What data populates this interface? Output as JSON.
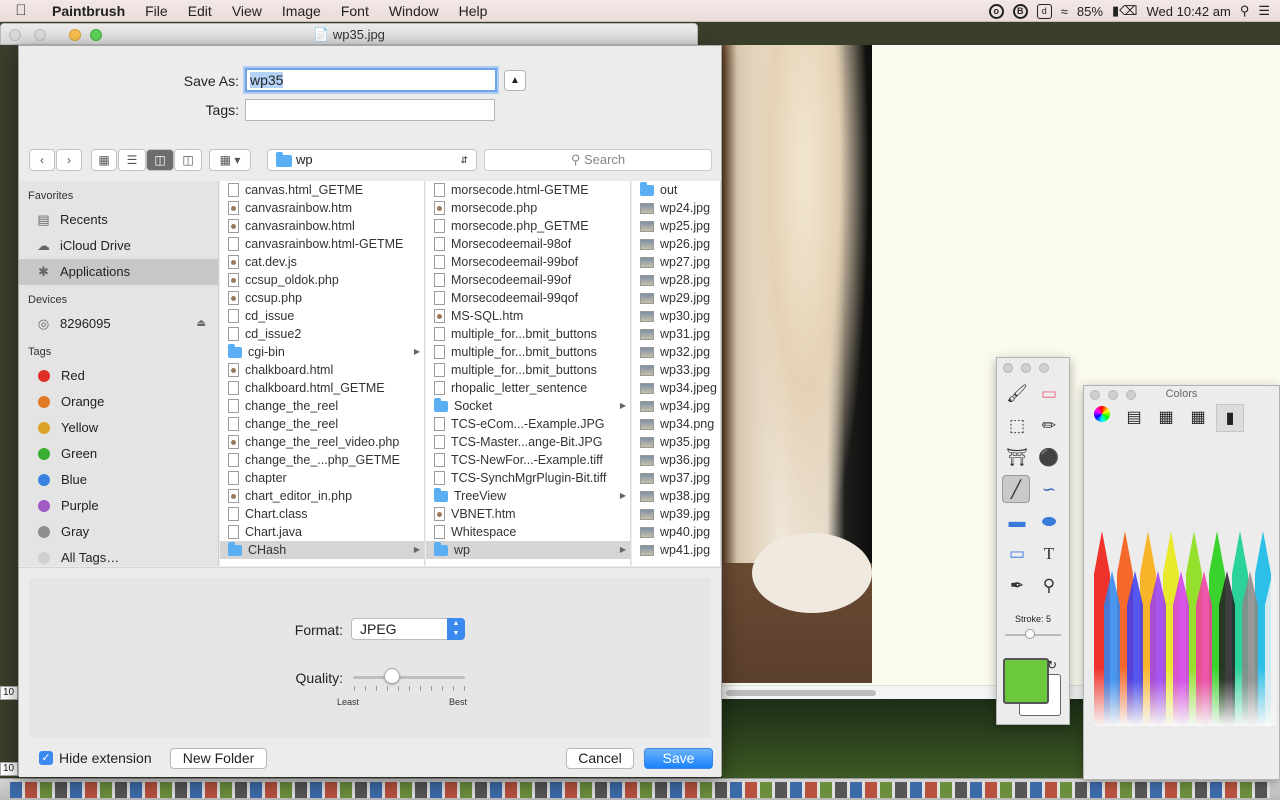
{
  "menubar": {
    "app": "Paintbrush",
    "items": [
      "File",
      "Edit",
      "View",
      "Image",
      "Font",
      "Window",
      "Help"
    ],
    "battery": "85%",
    "clock": "Wed 10:42 am"
  },
  "background_window": {
    "title": "wp35.jpg"
  },
  "save_sheet": {
    "save_as_label": "Save As:",
    "save_as_value": "wp35",
    "tags_label": "Tags:",
    "tags_value": "",
    "path": "wp",
    "search_placeholder": "Search",
    "sidebar": {
      "favorites_header": "Favorites",
      "favorites": [
        {
          "label": "Recents",
          "icon": "recents-icon"
        },
        {
          "label": "iCloud Drive",
          "icon": "cloud-icon"
        },
        {
          "label": "Applications",
          "icon": "applications-icon",
          "selected": true
        }
      ],
      "devices_header": "Devices",
      "devices": [
        {
          "label": "8296095",
          "icon": "disk-icon"
        }
      ],
      "tags_header": "Tags",
      "tags": [
        {
          "label": "Red",
          "color": "#e0302a"
        },
        {
          "label": "Orange",
          "color": "#e07a25"
        },
        {
          "label": "Yellow",
          "color": "#dca52a"
        },
        {
          "label": "Green",
          "color": "#3aae33"
        },
        {
          "label": "Blue",
          "color": "#3a82e0"
        },
        {
          "label": "Purple",
          "color": "#a05ac3"
        },
        {
          "label": "Gray",
          "color": "#8d8d8d"
        },
        {
          "label": "All Tags…",
          "color": "#d0d0d0"
        }
      ]
    },
    "columns": [
      {
        "items": [
          {
            "name": "canvas.html_GETME",
            "type": "doc"
          },
          {
            "name": "canvasrainbow.htm",
            "type": "html"
          },
          {
            "name": "canvasrainbow.html",
            "type": "html"
          },
          {
            "name": "canvasrainbow.html-GETME",
            "type": "doc"
          },
          {
            "name": "cat.dev.js",
            "type": "php"
          },
          {
            "name": "ccsup_oldok.php",
            "type": "php"
          },
          {
            "name": "ccsup.php",
            "type": "php"
          },
          {
            "name": "cd_issue",
            "type": "doc"
          },
          {
            "name": "cd_issue2",
            "type": "doc"
          },
          {
            "name": "cgi-bin",
            "type": "folder",
            "arrow": true
          },
          {
            "name": "chalkboard.html",
            "type": "html"
          },
          {
            "name": "chalkboard.html_GETME",
            "type": "doc"
          },
          {
            "name": "change_the_reel",
            "type": "doc"
          },
          {
            "name": "change_the_reel",
            "type": "doc"
          },
          {
            "name": "change_the_reel_video.php",
            "type": "php"
          },
          {
            "name": "change_the_...php_GETME",
            "type": "doc"
          },
          {
            "name": "chapter",
            "type": "doc"
          },
          {
            "name": "chart_editor_in.php",
            "type": "php"
          },
          {
            "name": "Chart.class",
            "type": "doc"
          },
          {
            "name": "Chart.java",
            "type": "doc"
          },
          {
            "name": "CHash",
            "type": "folder",
            "arrow": true,
            "selected": true
          }
        ]
      },
      {
        "items": [
          {
            "name": "morsecode.html-GETME",
            "type": "doc"
          },
          {
            "name": "morsecode.php",
            "type": "php"
          },
          {
            "name": "morsecode.php_GETME",
            "type": "doc"
          },
          {
            "name": "Morsecodeemail-98of",
            "type": "doc"
          },
          {
            "name": "Morsecodeemail-99bof",
            "type": "doc"
          },
          {
            "name": "Morsecodeemail-99of",
            "type": "doc"
          },
          {
            "name": "Morsecodeemail-99qof",
            "type": "doc"
          },
          {
            "name": "MS-SQL.htm",
            "type": "html"
          },
          {
            "name": "multiple_for...bmit_buttons",
            "type": "doc"
          },
          {
            "name": "multiple_for...bmit_buttons",
            "type": "doc"
          },
          {
            "name": "multiple_for...bmit_buttons",
            "type": "doc"
          },
          {
            "name": "rhopalic_letter_sentence",
            "type": "doc"
          },
          {
            "name": "Socket",
            "type": "folder",
            "arrow": true
          },
          {
            "name": "TCS-eCom...-Example.JPG",
            "type": "doc"
          },
          {
            "name": "TCS-Master...ange-Bit.JPG",
            "type": "doc"
          },
          {
            "name": "TCS-NewFor...-Example.tiff",
            "type": "doc"
          },
          {
            "name": "TCS-SynchMgrPlugin-Bit.tiff",
            "type": "doc"
          },
          {
            "name": "TreeView",
            "type": "folder",
            "arrow": true
          },
          {
            "name": "VBNET.htm",
            "type": "html"
          },
          {
            "name": "Whitespace",
            "type": "doc"
          },
          {
            "name": "wp",
            "type": "folder",
            "arrow": true,
            "selected": true
          }
        ]
      },
      {
        "items": [
          {
            "name": "out",
            "type": "folder"
          },
          {
            "name": "wp24.jpg",
            "type": "img"
          },
          {
            "name": "wp25.jpg",
            "type": "img"
          },
          {
            "name": "wp26.jpg",
            "type": "img"
          },
          {
            "name": "wp27.jpg",
            "type": "img"
          },
          {
            "name": "wp28.jpg",
            "type": "img"
          },
          {
            "name": "wp29.jpg",
            "type": "img"
          },
          {
            "name": "wp30.jpg",
            "type": "img"
          },
          {
            "name": "wp31.jpg",
            "type": "img"
          },
          {
            "name": "wp32.jpg",
            "type": "img"
          },
          {
            "name": "wp33.jpg",
            "type": "img"
          },
          {
            "name": "wp34.jpeg",
            "type": "img"
          },
          {
            "name": "wp34.jpg",
            "type": "img"
          },
          {
            "name": "wp34.png",
            "type": "img"
          },
          {
            "name": "wp35.jpg",
            "type": "img"
          },
          {
            "name": "wp36.jpg",
            "type": "img"
          },
          {
            "name": "wp37.jpg",
            "type": "img"
          },
          {
            "name": "wp38.jpg",
            "type": "img"
          },
          {
            "name": "wp39.jpg",
            "type": "img"
          },
          {
            "name": "wp40.jpg",
            "type": "img"
          },
          {
            "name": "wp41.jpg",
            "type": "img"
          }
        ]
      }
    ],
    "format_label": "Format:",
    "format_value": "JPEG",
    "quality_label": "Quality:",
    "quality_level": 0.35,
    "least_label": "Least",
    "best_label": "Best",
    "hide_extension_label": "Hide extension",
    "hide_extension_checked": true,
    "new_folder_label": "New Folder",
    "cancel_label": "Cancel",
    "save_label": "Save"
  },
  "tool_palette": {
    "stroke_label": "Stroke: 5",
    "stroke_value": 5,
    "primary_color": "#6cc93d",
    "secondary_color": "#ffffff"
  },
  "colors_panel": {
    "title": "Colors",
    "crayon_colors": [
      "#f0322c",
      "#f56a2c",
      "#f8b52c",
      "#e8e82c",
      "#94e02c",
      "#3ad22c",
      "#2cd29b",
      "#2cc0e8",
      "#2c86f0",
      "#3a3af0",
      "#9a3af0",
      "#d23ae8",
      "#f03aa0",
      "#202020",
      "#888888",
      "#f0f0f0"
    ]
  },
  "left_labels": [
    "10",
    "10"
  ]
}
